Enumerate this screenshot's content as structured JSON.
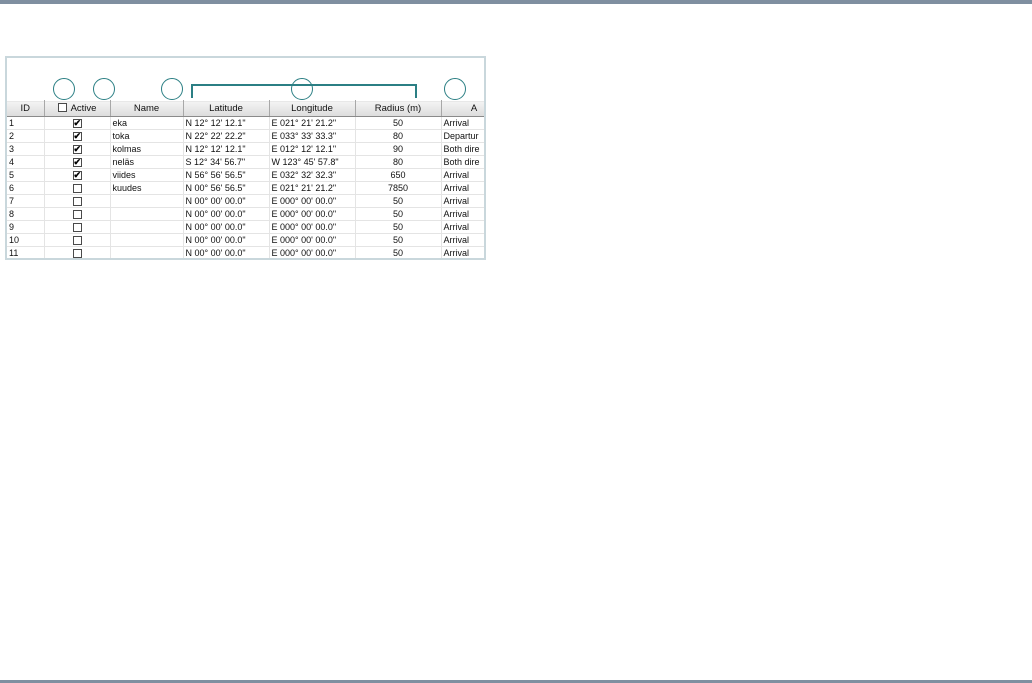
{
  "table": {
    "columns": [
      "ID",
      "Active",
      "Name",
      "Latitude",
      "Longitude",
      "Radius (m)",
      "A"
    ],
    "rows": [
      {
        "id": "1",
        "active": true,
        "name": "eka",
        "lat": "N 12° 12' 12.1\"",
        "lon": "E 021° 21' 21.2\"",
        "radius": "50",
        "a": "Arrival"
      },
      {
        "id": "2",
        "active": true,
        "name": "toka",
        "lat": "N 22° 22' 22.2\"",
        "lon": "E 033° 33' 33.3\"",
        "radius": "80",
        "a": "Departur"
      },
      {
        "id": "3",
        "active": true,
        "name": "kolmas",
        "lat": "N 12° 12' 12.1\"",
        "lon": "E 012° 12' 12.1\"",
        "radius": "90",
        "a": "Both dire"
      },
      {
        "id": "4",
        "active": true,
        "name": "neläs",
        "lat": "S 12° 34' 56.7\"",
        "lon": "W 123° 45' 57.8\"",
        "radius": "80",
        "a": "Both dire"
      },
      {
        "id": "5",
        "active": true,
        "name": "viides",
        "lat": "N 56° 56' 56.5\"",
        "lon": "E 032° 32' 32.3\"",
        "radius": "650",
        "a": "Arrival"
      },
      {
        "id": "6",
        "active": false,
        "name": "kuudes",
        "lat": "N 00° 56' 56.5\"",
        "lon": "E 021° 21' 21.2\"",
        "radius": "7850",
        "a": "Arrival"
      },
      {
        "id": "7",
        "active": false,
        "name": "",
        "lat": "N 00° 00' 00.0\"",
        "lon": "E 000° 00' 00.0\"",
        "radius": "50",
        "a": "Arrival"
      },
      {
        "id": "8",
        "active": false,
        "name": "",
        "lat": "N 00° 00' 00.0\"",
        "lon": "E 000° 00' 00.0\"",
        "radius": "50",
        "a": "Arrival"
      },
      {
        "id": "9",
        "active": false,
        "name": "",
        "lat": "N 00° 00' 00.0\"",
        "lon": "E 000° 00' 00.0\"",
        "radius": "50",
        "a": "Arrival"
      },
      {
        "id": "10",
        "active": false,
        "name": "",
        "lat": "N 00° 00' 00.0\"",
        "lon": "E 000° 00' 00.0\"",
        "radius": "50",
        "a": "Arrival"
      },
      {
        "id": "11",
        "active": false,
        "name": "",
        "lat": "N 00° 00' 00.0\"",
        "lon": "E 000° 00' 00.0\"",
        "radius": "50",
        "a": "Arrival"
      }
    ]
  },
  "check_mark": "✔",
  "colors": {
    "callout": "#2b7f84",
    "rule": "#7f8fa0",
    "frame": "#c9d7dc"
  }
}
